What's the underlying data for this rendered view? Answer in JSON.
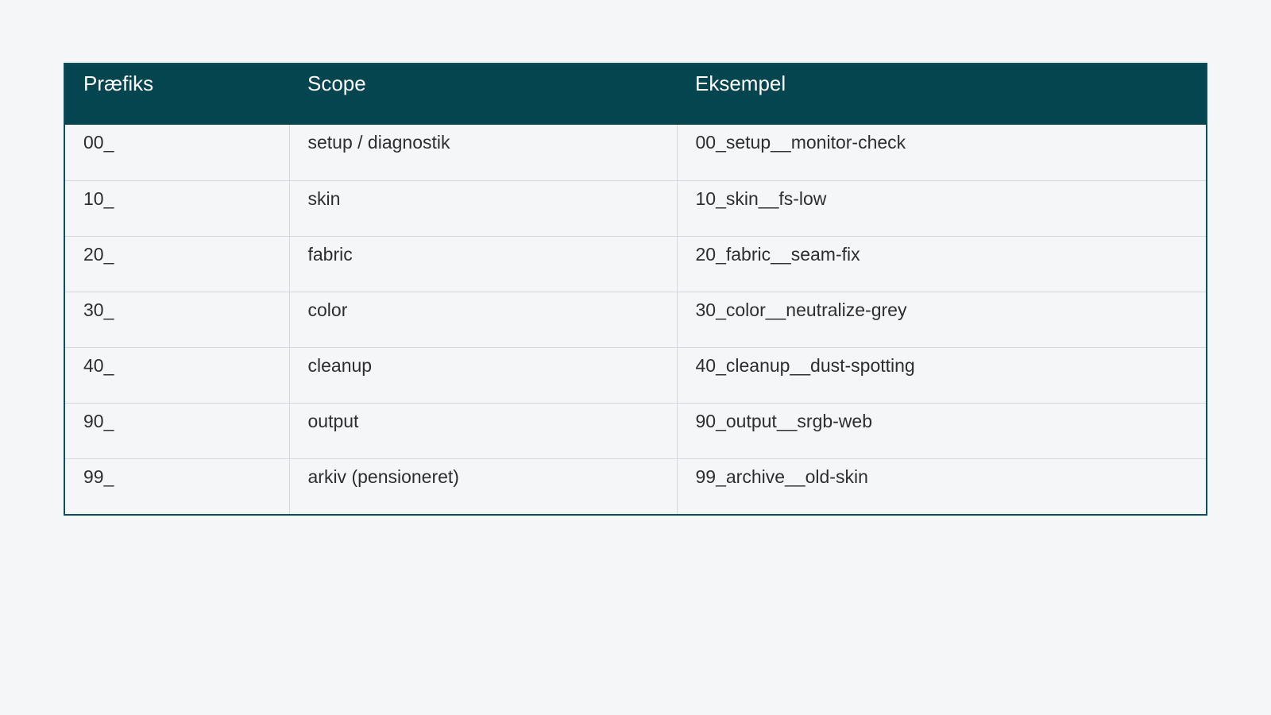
{
  "table": {
    "headers": [
      "Præfiks",
      "Scope",
      "Eksempel"
    ],
    "rows": [
      [
        "00_",
        "setup / diagnostik",
        "00_setup__monitor-check"
      ],
      [
        "10_",
        "skin",
        "10_skin__fs-low"
      ],
      [
        "20_",
        "fabric",
        "20_fabric__seam-fix"
      ],
      [
        "30_",
        "color",
        "30_color__neutralize-grey"
      ],
      [
        "40_",
        "cleanup",
        "40_cleanup__dust-spotting"
      ],
      [
        "90_",
        "output",
        "90_output__srgb-web"
      ],
      [
        "99_",
        "arkiv (pensioneret)",
        "99_archive__old-skin"
      ]
    ]
  },
  "colors": {
    "header_bg": "#04454f",
    "border": "#0b4f5c",
    "background": "#f4f6f8"
  }
}
